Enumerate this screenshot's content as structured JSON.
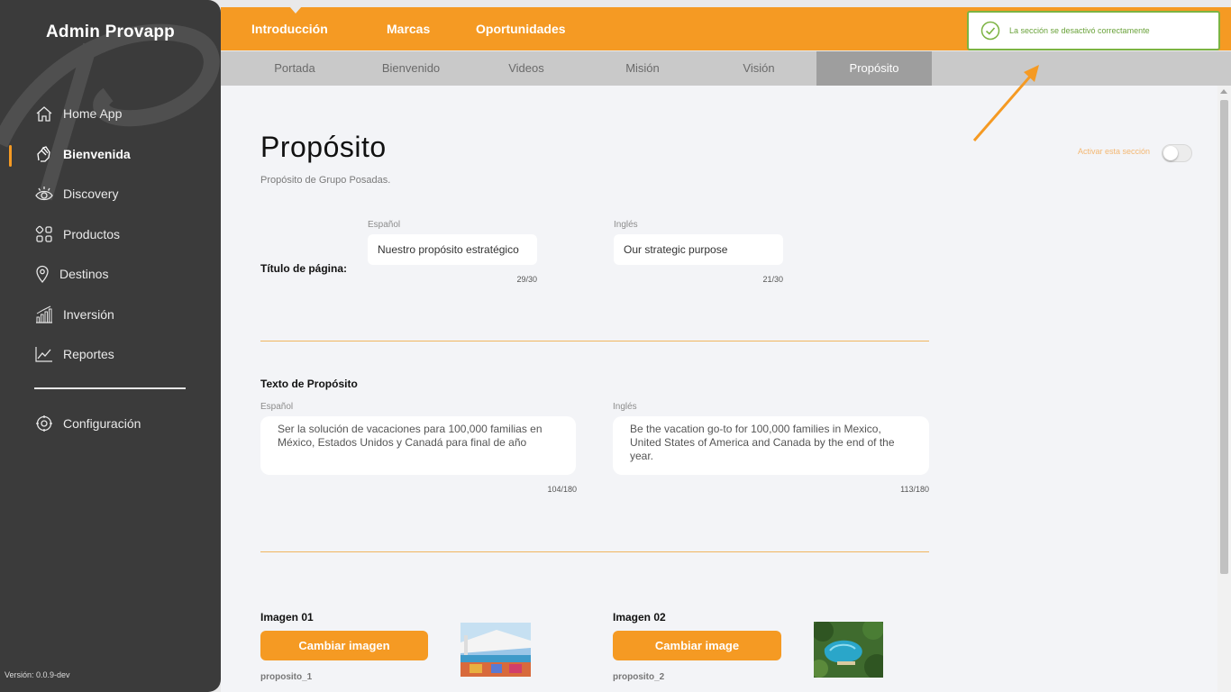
{
  "sidebar": {
    "brand": "Admin Provapp",
    "items": [
      {
        "label": "Home App",
        "icon": "home-icon"
      },
      {
        "label": "Bienvenida",
        "icon": "hands-icon"
      },
      {
        "label": "Discovery",
        "icon": "eye-icon"
      },
      {
        "label": "Productos",
        "icon": "grid-icon"
      },
      {
        "label": "Destinos",
        "icon": "map-pin-icon"
      },
      {
        "label": "Inversión",
        "icon": "bar-chart-icon"
      },
      {
        "label": "Reportes",
        "icon": "line-chart-icon"
      }
    ],
    "settings": {
      "label": "Configuración",
      "icon": "gear-icon"
    },
    "version": "Versión: 0.0.9-dev"
  },
  "topnav": {
    "tabs": [
      "Introducción",
      "Marcas",
      "Oportunidades"
    ]
  },
  "subnav": {
    "tabs": [
      "Portada",
      "Bienvenido",
      "Videos",
      "Misión",
      "Visión",
      "Propósito"
    ],
    "active": "Propósito"
  },
  "toast": {
    "message": "La sección se desactivó correctamente"
  },
  "page": {
    "title": "Propósito",
    "subtitle": "Propósito de Grupo Posadas.",
    "toggle_label": "Activar esta sección",
    "toggle_on": false
  },
  "title_section": {
    "label": "Título de página:",
    "es_label": "Español",
    "en_label": "Inglés",
    "es_value": "Nuestro propósito estratégico",
    "en_value": "Our strategic purpose",
    "es_count": "29/30",
    "en_count": "21/30"
  },
  "text_section": {
    "label": "Texto de Propósito",
    "es_label": "Español",
    "en_label": "Inglés",
    "es_value": "Ser la solución de vacaciones para 100,000 familias en México, Estados Unidos y Canadá para final de año",
    "en_value": "Be the vacation go-to for 100,000 families in Mexico, United States of America and Canada by the end of the year.",
    "es_count": "104/180",
    "en_count": "113/180"
  },
  "images": [
    {
      "label": "Imagen 01",
      "button": "Cambiar imagen",
      "filename": "proposito_1"
    },
    {
      "label": "Imagen 02",
      "button": "Cambiar image",
      "filename": "proposito_2"
    }
  ],
  "colors": {
    "accent": "#f59a23",
    "sidebar": "#3b3b3b",
    "success": "#7cb342"
  }
}
